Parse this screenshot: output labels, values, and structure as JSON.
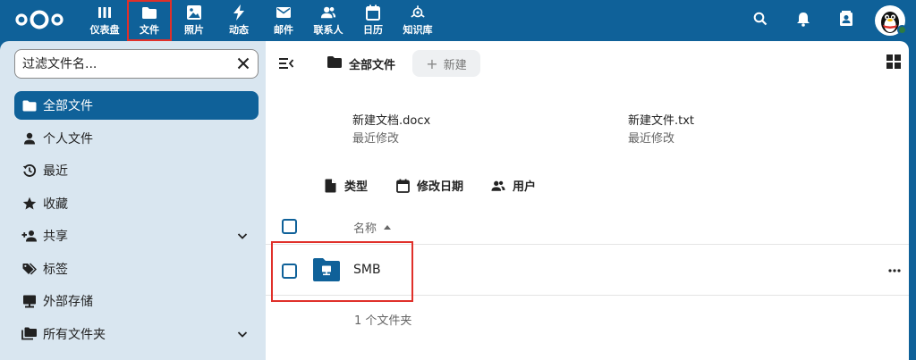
{
  "header": {
    "logo": "nextcloud-logo",
    "apps": [
      {
        "label": "仪表盘",
        "icon": "dashboard-icon",
        "active": false
      },
      {
        "label": "文件",
        "icon": "folder-icon",
        "active": true
      },
      {
        "label": "照片",
        "icon": "image-icon",
        "active": false
      },
      {
        "label": "动态",
        "icon": "lightning-icon",
        "active": false
      },
      {
        "label": "邮件",
        "icon": "mail-icon",
        "active": false
      },
      {
        "label": "联系人",
        "icon": "contacts-icon",
        "active": false
      },
      {
        "label": "日历",
        "icon": "calendar-icon",
        "active": false
      },
      {
        "label": "知识库",
        "icon": "knowledge-icon",
        "active": false
      }
    ],
    "right_icons": [
      "search-icon",
      "bell-icon",
      "contacts-card-icon"
    ],
    "avatar": "qq-penguin-avatar",
    "status": "online",
    "colors": {
      "primary": "#0f6199",
      "highlight": "#e0302a"
    }
  },
  "sidebar": {
    "filter_placeholder": "过滤文件名...",
    "items": [
      {
        "label": "全部文件",
        "icon": "folder-icon",
        "active": true,
        "expandable": false
      },
      {
        "label": "个人文件",
        "icon": "person-icon",
        "active": false,
        "expandable": false
      },
      {
        "label": "最近",
        "icon": "history-icon",
        "active": false,
        "expandable": false
      },
      {
        "label": "收藏",
        "icon": "star-icon",
        "active": false,
        "expandable": false
      },
      {
        "label": "共享",
        "icon": "share-person-icon",
        "active": false,
        "expandable": true
      },
      {
        "label": "标签",
        "icon": "tag-icon",
        "active": false,
        "expandable": false
      },
      {
        "label": "外部存储",
        "icon": "external-storage-icon",
        "active": false,
        "expandable": false
      },
      {
        "label": "所有文件夹",
        "icon": "folders-icon",
        "active": false,
        "expandable": true
      }
    ]
  },
  "main": {
    "breadcrumb": "全部文件",
    "new_button": "新建",
    "recent_files": [
      {
        "name": "新建文档.docx",
        "sub": "最近修改"
      },
      {
        "name": "新建文件.txt",
        "sub": "最近修改"
      }
    ],
    "filters": [
      {
        "label": "类型",
        "icon": "file-icon"
      },
      {
        "label": "修改日期",
        "icon": "calendar-icon"
      },
      {
        "label": "用户",
        "icon": "users-icon"
      }
    ],
    "column_name": "名称",
    "rows": [
      {
        "name": "SMB",
        "icon": "external-folder-icon"
      }
    ],
    "summary": "1 个文件夹"
  }
}
